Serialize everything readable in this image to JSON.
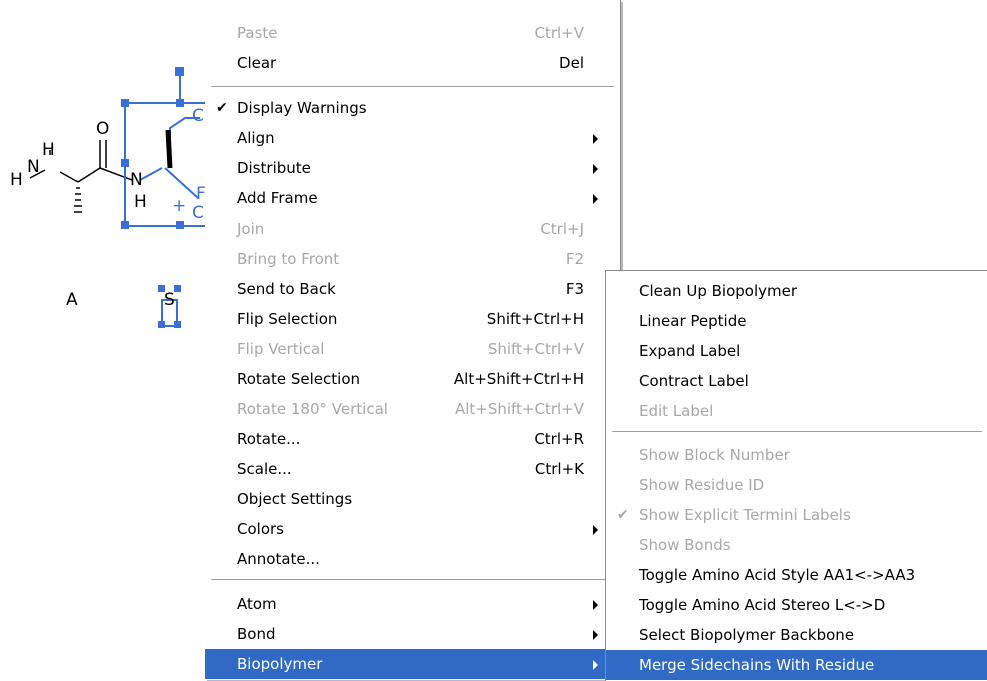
{
  "canvas": {
    "molecule_atoms": {
      "h_top": "H",
      "n_left": "N",
      "h_left": "H",
      "o_carbonyl": "O",
      "n_selected": "N",
      "h_selected": "H",
      "plus": "+",
      "o_partial_top": "C",
      "o_partial_bottom": "C",
      "f_partial": "F"
    },
    "residue_labels": {
      "a": "A",
      "s": "S"
    },
    "colors": {
      "selection": "#3a6fd8"
    }
  },
  "main_menu": {
    "items": [
      {
        "label": "Paste",
        "shortcut": "Ctrl+V",
        "disabled": true
      },
      {
        "label": "Clear",
        "shortcut": "Del"
      },
      {
        "label": "Display Warnings",
        "checked": true
      },
      {
        "label": "Align",
        "submenu": true
      },
      {
        "label": "Distribute",
        "submenu": true
      },
      {
        "label": "Add Frame",
        "submenu": true
      },
      {
        "label": "Join",
        "shortcut": "Ctrl+J",
        "disabled": true
      },
      {
        "label": "Bring to Front",
        "shortcut": "F2",
        "disabled": true
      },
      {
        "label": "Send to Back",
        "shortcut": "F3"
      },
      {
        "label": "Flip Selection",
        "shortcut": "Shift+Ctrl+H"
      },
      {
        "label": "Flip Vertical",
        "shortcut": "Shift+Ctrl+V",
        "disabled": true
      },
      {
        "label": "Rotate Selection",
        "shortcut": "Alt+Shift+Ctrl+H"
      },
      {
        "label": "Rotate 180° Vertical",
        "shortcut": "Alt+Shift+Ctrl+V",
        "disabled": true
      },
      {
        "label": "Rotate...",
        "shortcut": "Ctrl+R"
      },
      {
        "label": "Scale...",
        "shortcut": "Ctrl+K"
      },
      {
        "label": "Object Settings"
      },
      {
        "label": "Colors",
        "submenu": true
      },
      {
        "label": "Annotate..."
      },
      {
        "label": "Atom",
        "submenu": true
      },
      {
        "label": "Bond",
        "submenu": true
      },
      {
        "label": "Biopolymer",
        "submenu": true,
        "active": true
      }
    ]
  },
  "sub_menu": {
    "items": [
      {
        "label": "Clean Up Biopolymer"
      },
      {
        "label": "Linear Peptide"
      },
      {
        "label": "Expand Label"
      },
      {
        "label": "Contract Label"
      },
      {
        "label": "Edit Label",
        "disabled": true
      },
      {
        "label": "Show Block Number",
        "disabled": true
      },
      {
        "label": "Show Residue ID",
        "disabled": true
      },
      {
        "label": "Show Explicit Termini Labels",
        "disabled": true,
        "checked": true
      },
      {
        "label": "Show Bonds",
        "disabled": true
      },
      {
        "label": "Toggle Amino Acid Style AA1<->AA3"
      },
      {
        "label": "Toggle Amino Acid Stereo L<->D"
      },
      {
        "label": "Select Biopolymer Backbone"
      },
      {
        "label": "Merge Sidechains With Residue",
        "active": true
      }
    ]
  },
  "icons": {
    "check": "check-icon",
    "submenu_arrow": "submenu-arrow-icon"
  },
  "colors": {
    "highlight": "#316ac5",
    "disabled_text": "#a8a8a8"
  }
}
